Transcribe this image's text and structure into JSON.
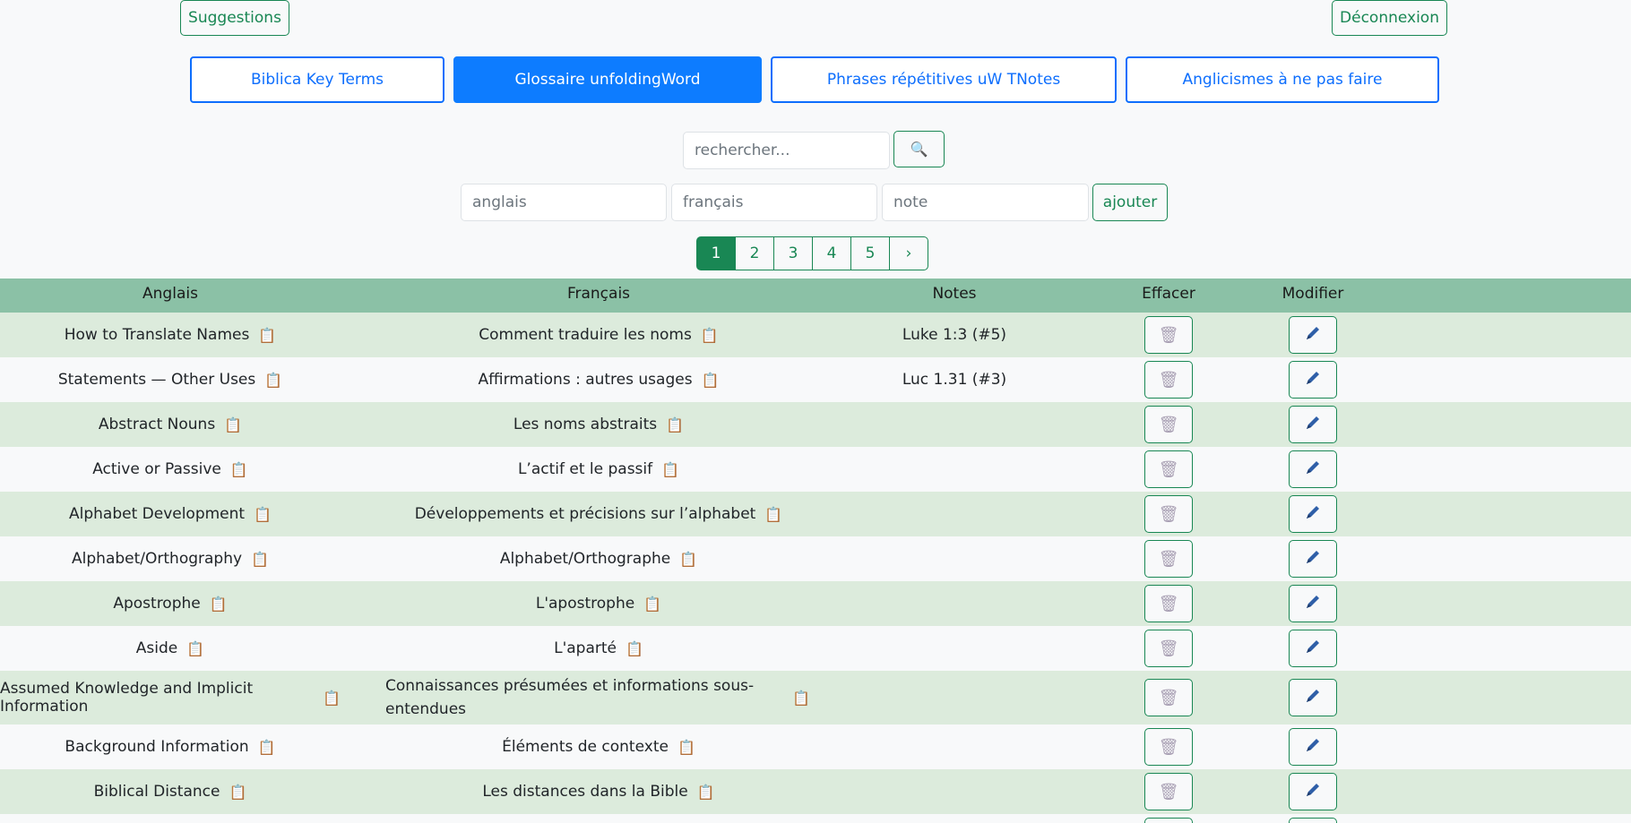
{
  "header": {
    "suggestions_label": "Suggestions",
    "logout_label": "Déconnexion"
  },
  "tabs": [
    {
      "label": "Biblica Key Terms",
      "active": false
    },
    {
      "label": "Glossaire unfoldingWord",
      "active": true
    },
    {
      "label": "Phrases répétitives uW TNotes",
      "active": false
    },
    {
      "label": "Anglicismes à ne pas faire",
      "active": false
    }
  ],
  "search": {
    "placeholder": "rechercher...",
    "button_icon": "magnifier-icon",
    "button_glyph": "🔍"
  },
  "add_form": {
    "english_placeholder": "anglais",
    "french_placeholder": "français",
    "note_placeholder": "note",
    "add_label": "ajouter"
  },
  "pagination": {
    "pages": [
      "1",
      "2",
      "3",
      "4",
      "5"
    ],
    "current": "1",
    "next_label": "›"
  },
  "table": {
    "headers": {
      "english": "Anglais",
      "french": "Français",
      "notes": "Notes",
      "delete": "Effacer",
      "edit": "Modifier"
    },
    "copy_glyph": "📋",
    "delete_glyph": "🗑",
    "rows": [
      {
        "english": "How to Translate Names",
        "french": "Comment traduire les noms",
        "note": "Luke 1:3 (#5)"
      },
      {
        "english": "Statements — Other Uses",
        "french": "Affirmations : autres usages",
        "note": "Luc 1.31 (#3)"
      },
      {
        "english": "Abstract Nouns",
        "french": "Les noms abstraits",
        "note": ""
      },
      {
        "english": "Active or Passive",
        "french": "L’actif et le passif",
        "note": ""
      },
      {
        "english": "Alphabet Development",
        "french": "Développements et précisions sur l’alphabet",
        "note": ""
      },
      {
        "english": "Alphabet/Orthography",
        "french": "Alphabet/Orthographe",
        "note": ""
      },
      {
        "english": "Apostrophe",
        "french": "L'apostrophe",
        "note": ""
      },
      {
        "english": "Aside",
        "french": "L'aparté",
        "note": ""
      },
      {
        "english": "Assumed Knowledge and Implicit Information",
        "french": "Connaissances présumées et informations sous-entendues",
        "note": ""
      },
      {
        "english": "Background Information",
        "french": "Éléments de contexte",
        "note": ""
      },
      {
        "english": "Biblical Distance",
        "french": "Les distances dans la Bible",
        "note": ""
      },
      {
        "english": "",
        "french": "",
        "note": ""
      }
    ]
  }
}
